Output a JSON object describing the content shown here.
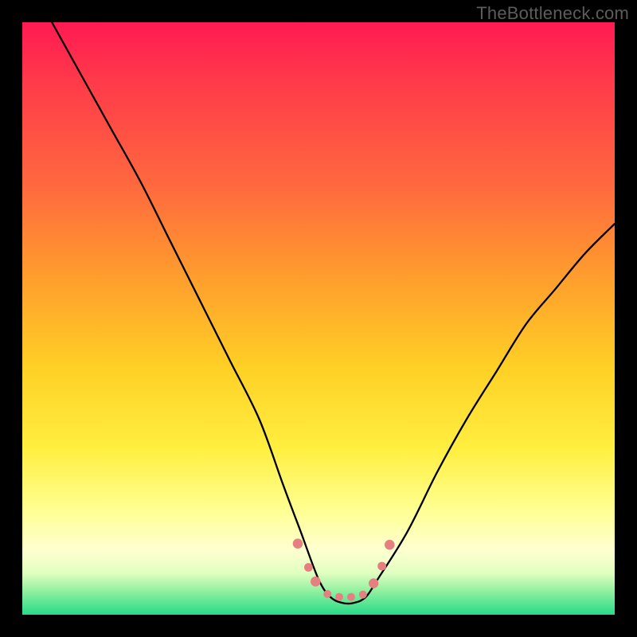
{
  "watermark": "TheBottleneck.com",
  "chart_data": {
    "type": "line",
    "title": "",
    "xlabel": "",
    "ylabel": "",
    "xlim": [
      0,
      100
    ],
    "ylim": [
      0,
      100
    ],
    "series": [
      {
        "name": "bottleneck-curve",
        "x": [
          5,
          10,
          15,
          20,
          25,
          30,
          35,
          40,
          44,
          47,
          50,
          52,
          54,
          56,
          58,
          60,
          65,
          70,
          75,
          80,
          85,
          90,
          95,
          100
        ],
        "y": [
          100,
          91,
          82,
          73,
          63,
          53,
          43,
          33,
          22,
          14,
          6,
          3,
          2,
          2,
          3,
          6,
          14,
          24,
          33,
          41,
          49,
          55,
          61,
          66
        ]
      }
    ],
    "markers": {
      "name": "bottom-dots",
      "color": "#e68080",
      "x": [
        46.5,
        48.3,
        49.5,
        51.5,
        53.5,
        55.5,
        57.5,
        59.3,
        60.7,
        62.0
      ],
      "y": [
        12.0,
        8.0,
        5.6,
        3.5,
        3.0,
        3.0,
        3.4,
        5.3,
        8.2,
        11.8
      ],
      "radius": [
        6.3,
        5.4,
        6.3,
        5.0,
        5.0,
        5.0,
        5.0,
        6.2,
        5.4,
        6.3
      ]
    },
    "gradient_stops": [
      {
        "pos": 0,
        "color": "#ff1a53"
      },
      {
        "pos": 10,
        "color": "#ff3a4a"
      },
      {
        "pos": 28,
        "color": "#ff6a3e"
      },
      {
        "pos": 42,
        "color": "#ff9a2e"
      },
      {
        "pos": 58,
        "color": "#ffcf25"
      },
      {
        "pos": 72,
        "color": "#ffef40"
      },
      {
        "pos": 82,
        "color": "#ffff90"
      },
      {
        "pos": 89,
        "color": "#ffffd0"
      },
      {
        "pos": 93,
        "color": "#e0ffc0"
      },
      {
        "pos": 96,
        "color": "#90f0a0"
      },
      {
        "pos": 100,
        "color": "#27db88"
      }
    ]
  }
}
